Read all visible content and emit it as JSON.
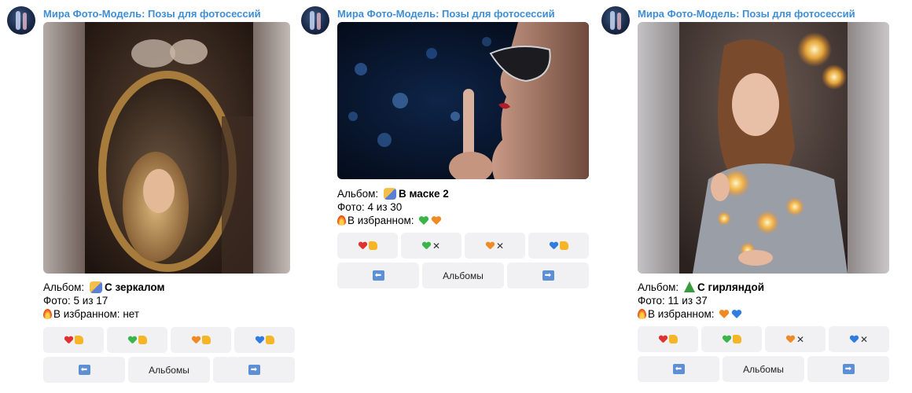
{
  "channel_name": "Мира Фото-Модель: Позы для фотосессий",
  "posts": [
    {
      "album_label": "Альбом:",
      "album_name": "С зеркалом",
      "photo_count": "Фото: 5 из 17",
      "favorites_label": "В избранном:",
      "favorites_value": "нет",
      "reactions": [
        {
          "heart_color": "#e03131",
          "action": "thumb"
        },
        {
          "heart_color": "#3bb54a",
          "action": "thumb"
        },
        {
          "heart_color": "#f08a24",
          "action": "thumb"
        },
        {
          "heart_color": "#2f7de1",
          "action": "thumb"
        }
      ],
      "nav": {
        "prev": "⬅",
        "albums": "Альбомы",
        "next": "➡"
      }
    },
    {
      "album_label": "Альбом:",
      "album_name": "В маске 2",
      "photo_count": "Фото: 4 из 30",
      "favorites_label": "В избранном:",
      "favorites_hearts": [
        "#3bb54a",
        "#f08a24"
      ],
      "reactions": [
        {
          "heart_color": "#e03131",
          "action": "thumb"
        },
        {
          "heart_color": "#3bb54a",
          "action": "x"
        },
        {
          "heart_color": "#f08a24",
          "action": "x"
        },
        {
          "heart_color": "#2f7de1",
          "action": "thumb"
        }
      ],
      "nav": {
        "prev": "⬅",
        "albums": "Альбомы",
        "next": "➡"
      }
    },
    {
      "album_label": "Альбом:",
      "album_name": "С гирляндой",
      "photo_count": "Фото: 11 из 37",
      "favorites_label": "В избранном:",
      "favorites_hearts": [
        "#f08a24",
        "#2f7de1"
      ],
      "reactions": [
        {
          "heart_color": "#e03131",
          "action": "thumb"
        },
        {
          "heart_color": "#3bb54a",
          "action": "thumb"
        },
        {
          "heart_color": "#f08a24",
          "action": "x"
        },
        {
          "heart_color": "#2f7de1",
          "action": "x"
        }
      ],
      "nav": {
        "prev": "⬅",
        "albums": "Альбомы",
        "next": "➡"
      }
    }
  ]
}
